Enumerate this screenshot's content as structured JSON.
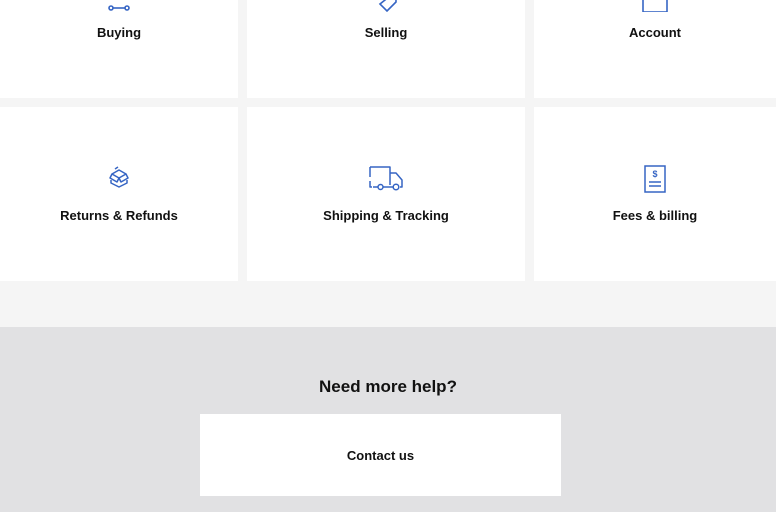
{
  "colors": {
    "icon": "#3665c4",
    "page_bg": "#f5f5f5",
    "help_bg": "#e1e1e3",
    "tile_bg": "#ffffff",
    "text": "#111111"
  },
  "topics": [
    {
      "label": "Buying",
      "icon": "connector-icon"
    },
    {
      "label": "Selling",
      "icon": "tag-icon"
    },
    {
      "label": "Account",
      "icon": "account-card-icon"
    },
    {
      "label": "Returns & Refunds",
      "icon": "box-return-icon"
    },
    {
      "label": "Shipping & Tracking",
      "icon": "truck-icon"
    },
    {
      "label": "Fees & billing",
      "icon": "invoice-icon"
    }
  ],
  "help": {
    "title": "Need more help?",
    "contact_label": "Contact us"
  }
}
